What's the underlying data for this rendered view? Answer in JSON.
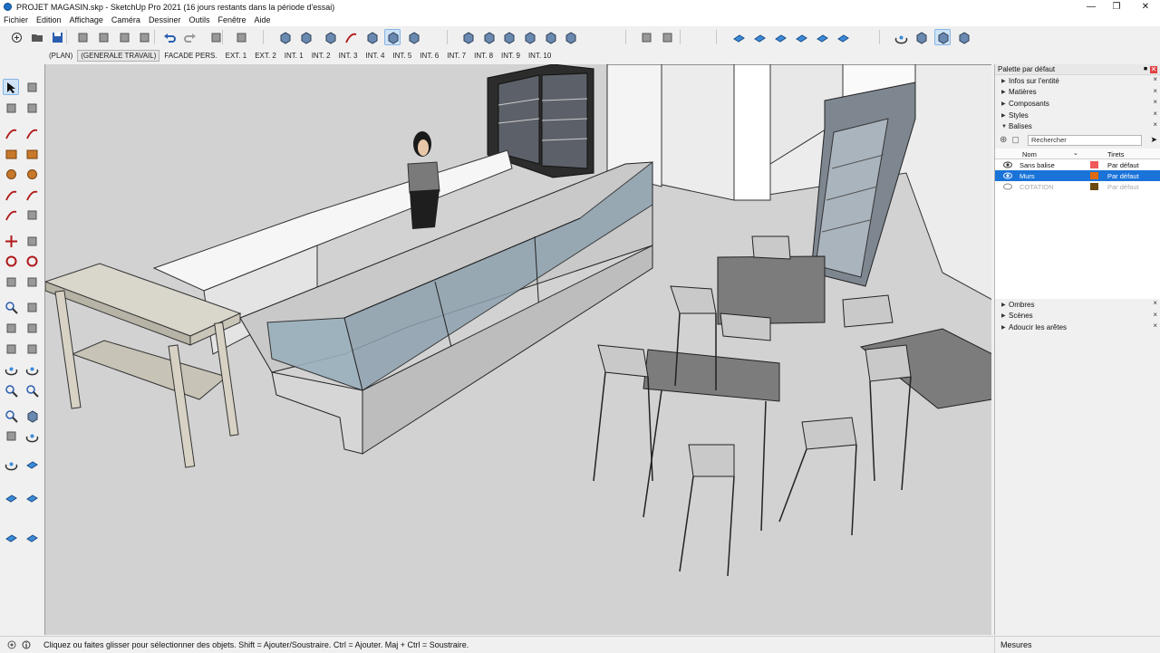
{
  "window": {
    "title": "PROJET MAGASIN.skp - SketchUp Pro 2021 (16 jours restants dans la période d'essai)"
  },
  "menu": [
    "Fichier",
    "Edition",
    "Affichage",
    "Caméra",
    "Dessiner",
    "Outils",
    "Fenêtre",
    "Aide"
  ],
  "scenes": [
    "(PLAN)",
    "(GENERALE TRAVAIL)",
    "FACADE PERS.",
    "EXT. 1",
    "EXT. 2",
    "INT. 1",
    "INT. 2",
    "INT. 3",
    "INT. 4",
    "INT. 5",
    "INT. 6",
    "INT. 7",
    "INT. 8",
    "INT. 9",
    "INT. 10"
  ],
  "tray": {
    "title": "Palette par défaut",
    "sections": [
      "Infos sur l'entité",
      "Matières",
      "Composants",
      "Styles",
      "Balises"
    ],
    "tags": {
      "search_placeholder": "Rechercher",
      "col_name": "Nom",
      "col_dashes": "Tirets",
      "rows": [
        {
          "name": "Sans balise",
          "color": "#f05a5a",
          "dashes": "Par défaut",
          "visible": true,
          "selected": false
        },
        {
          "name": "Murs",
          "color": "#e06a10",
          "dashes": "Par défaut",
          "visible": true,
          "selected": true
        },
        {
          "name": "COTATION",
          "color": "#6b4a12",
          "dashes": "Par défaut",
          "visible": false,
          "selected": false
        }
      ]
    },
    "sections_after": [
      "Ombres",
      "Scènes",
      "Adoucir les arêtes"
    ]
  },
  "status": {
    "message": "Cliquez ou faites glisser pour sélectionner des objets. Shift = Ajouter/Soustraire. Ctrl = Ajouter. Maj + Ctrl = Soustraire.",
    "measure_label": "Mesures"
  },
  "icons": {
    "top_toolbar": [
      "new-icon",
      "open-icon",
      "save-icon",
      "cut-icon",
      "copy-icon",
      "paste-icon",
      "erase-icon",
      "undo-icon",
      "redo-icon",
      "print-icon",
      "model-info-icon",
      "xray-icon",
      "back-edges-icon",
      "wireframe-icon",
      "hidden-line-icon",
      "shaded-icon",
      "shaded-textures-icon",
      "monochrome-icon",
      "iso-view-icon",
      "top-view-icon",
      "front-view-icon",
      "right-view-icon",
      "back-view-icon",
      "left-view-icon",
      "warehouse-icon",
      "extension-icon",
      "section-plane-icon",
      "section-display-icon",
      "section-cuts-icon",
      "section-fill-icon",
      "section-a-icon",
      "section-b-icon",
      "orbit-icon",
      "style-1-icon",
      "style-2-icon",
      "style-3-icon"
    ],
    "left_toolbar": [
      "select-icon",
      "component-icon",
      "paint-bucket-icon",
      "eraser-icon",
      "line-icon",
      "freehand-icon",
      "rectangle-icon",
      "rotated-rectangle-icon",
      "circle-icon",
      "polygon-icon",
      "arc-icon",
      "two-point-arc-icon",
      "three-point-arc-icon",
      "pie-icon",
      "move-icon",
      "push-pull-icon",
      "rotate-icon",
      "follow-me-icon",
      "scale-icon",
      "offset-icon",
      "tape-measure-icon",
      "dimension-icon",
      "protractor-icon",
      "text-icon",
      "axes-icon",
      "3d-text-icon",
      "orbit-icon",
      "pan-icon",
      "zoom-icon",
      "zoom-window-icon",
      "zoom-extents-icon",
      "previous-view-icon",
      "position-camera-icon",
      "look-around-icon",
      "walk-icon",
      "section-plane-icon",
      "sandbox-icon",
      "sandbox-stamp-icon",
      "sandbox-drape-icon",
      "sandbox-flip-icon"
    ]
  }
}
